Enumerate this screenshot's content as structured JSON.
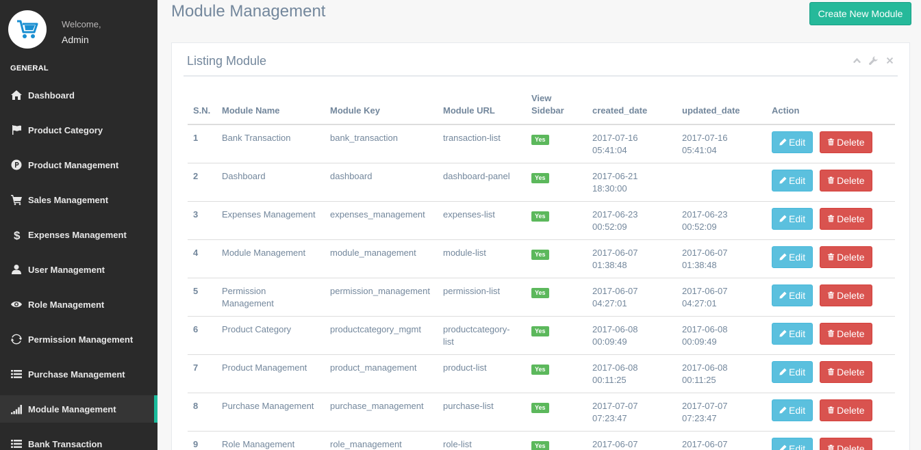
{
  "sidebar": {
    "welcome": "Welcome,",
    "user": "Admin",
    "section": "GENERAL",
    "items": [
      {
        "label": "Dashboard",
        "icon": "home-icon"
      },
      {
        "label": "Product Category",
        "icon": "flag-icon"
      },
      {
        "label": "Product Management",
        "icon": "product-p-icon"
      },
      {
        "label": "Sales Management",
        "icon": "cart-icon"
      },
      {
        "label": "Expenses Management",
        "icon": "dollar-icon"
      },
      {
        "label": "User Management",
        "icon": "user-icon"
      },
      {
        "label": "Role Management",
        "icon": "eye-icon"
      },
      {
        "label": "Permission Management",
        "icon": "refresh-icon"
      },
      {
        "label": "Purchase Management",
        "icon": "list-icon"
      },
      {
        "label": "Module Management",
        "icon": "signal-icon",
        "active": true
      },
      {
        "label": "Bank Transaction",
        "icon": "list-icon"
      }
    ]
  },
  "header": {
    "title": "Module Management",
    "create_button": "Create New Module"
  },
  "panel": {
    "title": "Listing Module"
  },
  "table": {
    "headers": [
      "S.N.",
      "Module Name",
      "Module Key",
      "Module URL",
      "View Sidebar",
      "created_date",
      "updated_date",
      "Action"
    ],
    "edit_label": "Edit",
    "delete_label": "Delete",
    "rows": [
      {
        "sn": "1",
        "name": "Bank Transaction",
        "key": "bank_transaction",
        "url": "transaction-list",
        "sidebar": "Yes",
        "created": "2017-07-16 05:41:04",
        "updated": "2017-07-16 05:41:04"
      },
      {
        "sn": "2",
        "name": "Dashboard",
        "key": "dashboard",
        "url": "dashboard-panel",
        "sidebar": "Yes",
        "created": "2017-06-21 18:30:00",
        "updated": ""
      },
      {
        "sn": "3",
        "name": "Expenses Management",
        "key": "expenses_management",
        "url": "expenses-list",
        "sidebar": "Yes",
        "created": "2017-06-23 00:52:09",
        "updated": "2017-06-23 00:52:09"
      },
      {
        "sn": "4",
        "name": "Module Management",
        "key": "module_management",
        "url": "module-list",
        "sidebar": "Yes",
        "created": "2017-06-07 01:38:48",
        "updated": "2017-06-07 01:38:48"
      },
      {
        "sn": "5",
        "name": "Permission Management",
        "key": "permission_management",
        "url": "permission-list",
        "sidebar": "Yes",
        "created": "2017-06-07 04:27:01",
        "updated": "2017-06-07 04:27:01"
      },
      {
        "sn": "6",
        "name": "Product Category",
        "key": "productcategory_mgmt",
        "url": "productcategory-list",
        "sidebar": "Yes",
        "created": "2017-06-08 00:09:49",
        "updated": "2017-06-08 00:09:49"
      },
      {
        "sn": "7",
        "name": "Product Management",
        "key": "product_management",
        "url": "product-list",
        "sidebar": "Yes",
        "created": "2017-06-08 00:11:25",
        "updated": "2017-06-08 00:11:25"
      },
      {
        "sn": "8",
        "name": "Purchase Management",
        "key": "purchase_management",
        "url": "purchase-list",
        "sidebar": "Yes",
        "created": "2017-07-07 07:23:47",
        "updated": "2017-07-07 07:23:47"
      },
      {
        "sn": "9",
        "name": "Role Management",
        "key": "role_management",
        "url": "role-list",
        "sidebar": "Yes",
        "created": "2017-06-07",
        "updated": "2017-06-07"
      }
    ]
  },
  "colors": {
    "sidebar_bg": "#2a2a2a",
    "accent": "#1abb9c",
    "create_btn": "#26b99a",
    "edit_btn": "#5bc0de",
    "delete_btn": "#d9534f",
    "badge": "#5cb85c"
  }
}
